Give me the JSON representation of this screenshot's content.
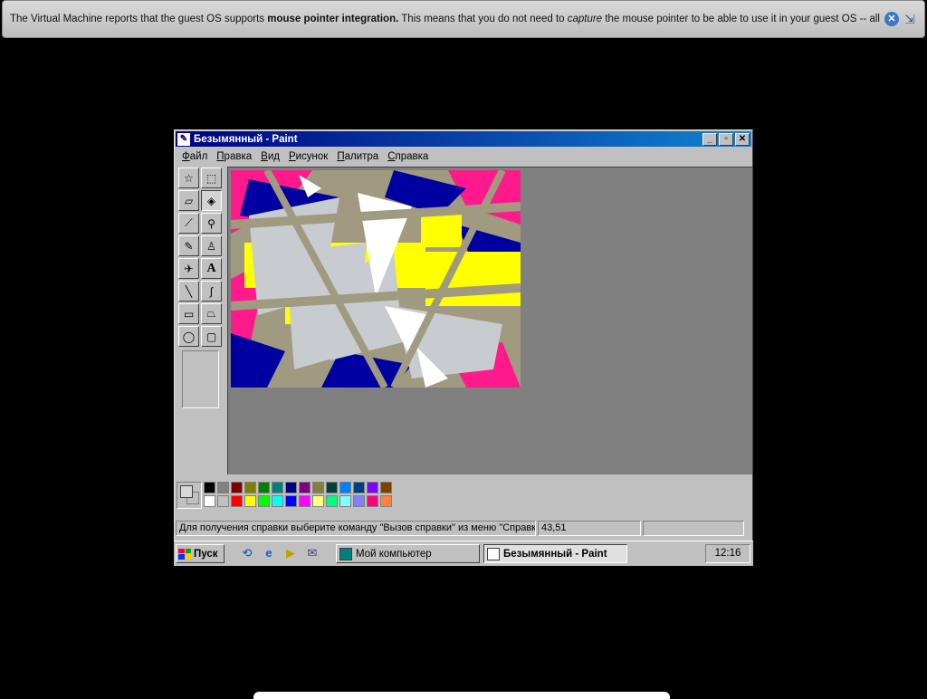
{
  "vm_notice": {
    "prefix": "The Virtual Machine reports that the guest OS supports ",
    "bold": "mouse pointer integration.",
    "middle": " This means that you do not need to ",
    "italic": "capture",
    "suffix": " the mouse pointer to be able to use it in your guest OS -- all mouse"
  },
  "window": {
    "title": "Безымянный - Paint",
    "minimize": "_",
    "maximize": "▫",
    "close": "✕"
  },
  "menu": [
    "Файл",
    "Правка",
    "Вид",
    "Рисунок",
    "Палитра",
    "Справка"
  ],
  "tools": [
    {
      "name": "free-select-tool",
      "glyph": "☆",
      "pressed": false
    },
    {
      "name": "rect-select-tool",
      "glyph": "⬚",
      "pressed": false
    },
    {
      "name": "eraser-tool",
      "glyph": "▱",
      "pressed": false
    },
    {
      "name": "fill-tool",
      "glyph": "◈",
      "pressed": true
    },
    {
      "name": "pick-color-tool",
      "glyph": "⟋",
      "pressed": false
    },
    {
      "name": "magnifier-tool",
      "glyph": "⚲",
      "pressed": false
    },
    {
      "name": "pencil-tool",
      "glyph": "✎",
      "pressed": false
    },
    {
      "name": "brush-tool",
      "glyph": "♙",
      "pressed": false
    },
    {
      "name": "airbrush-tool",
      "glyph": "✈",
      "pressed": false
    },
    {
      "name": "text-tool",
      "glyph": "A",
      "pressed": false
    },
    {
      "name": "line-tool",
      "glyph": "╲",
      "pressed": false
    },
    {
      "name": "curve-tool",
      "glyph": "∫",
      "pressed": false
    },
    {
      "name": "rectangle-tool",
      "glyph": "▭",
      "pressed": false
    },
    {
      "name": "polygon-tool",
      "glyph": "⏢",
      "pressed": false
    },
    {
      "name": "ellipse-tool",
      "glyph": "◯",
      "pressed": false
    },
    {
      "name": "rounded-rect-tool",
      "glyph": "▢",
      "pressed": false
    }
  ],
  "palette": {
    "foreground": "#d8d8d8",
    "background": "#c0c0c0",
    "row1": [
      "#000000",
      "#808080",
      "#800000",
      "#808000",
      "#008000",
      "#008080",
      "#000080",
      "#800080",
      "#808040",
      "#004040",
      "#0080ff",
      "#004080",
      "#8000ff",
      "#804000"
    ],
    "row2": [
      "#ffffff",
      "#c0c0c0",
      "#ff0000",
      "#ffff00",
      "#00ff00",
      "#00ffff",
      "#0000ff",
      "#ff00ff",
      "#ffff80",
      "#00ff80",
      "#80ffff",
      "#8080ff",
      "#ff0080",
      "#ff8040"
    ]
  },
  "status": {
    "help": "Для получения справки выберите команду \"Вызов справки\" из меню \"Справка\".",
    "coords": "43,51",
    "size": ""
  },
  "taskbar": {
    "start": "Пуск",
    "tasks": [
      "Мой компьютер",
      "Безымянный - Paint"
    ],
    "clock": "12:16"
  }
}
